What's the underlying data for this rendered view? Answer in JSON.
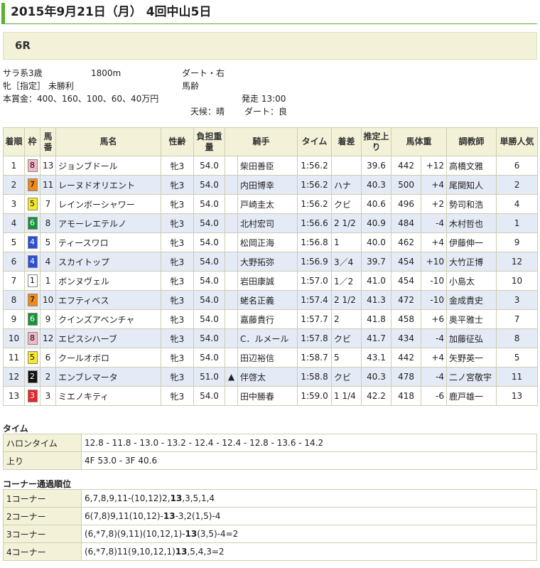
{
  "header": {
    "title": "2015年9月21日（月） 4回中山5日"
  },
  "race": {
    "name": "6R",
    "class_line": "サラ系3歳",
    "distance": "1800m",
    "track": "ダート・右",
    "conditions": "牝［指定］ 未勝利",
    "weight_rule": "馬齢",
    "prize": "本賞金：400、160、100、60、40万円",
    "start": "発走 13:00",
    "weather": "天候：晴",
    "going": "ダート：良"
  },
  "table": {
    "headers": [
      "着順",
      "枠",
      "馬番",
      "馬名",
      "性齢",
      "負担重量",
      "騎手",
      "タイム",
      "着差",
      "推定上り",
      "馬体重",
      "調教師",
      "単勝人気"
    ],
    "rows": [
      {
        "pos": "1",
        "waku": "8",
        "num": "13",
        "name": "ジョンブドール",
        "sex": "牝3",
        "wt": "54.0",
        "mark": "",
        "jockey": "柴田善臣",
        "time": "1:56.2",
        "margin": "",
        "last": "39.6",
        "bw": "442",
        "diff": "+12",
        "trainer": "高橋文雅",
        "pop": "6"
      },
      {
        "pos": "2",
        "waku": "7",
        "num": "11",
        "name": "レーヌドオリエント",
        "sex": "牝3",
        "wt": "54.0",
        "mark": "",
        "jockey": "内田博幸",
        "time": "1:56.2",
        "margin": "ハナ",
        "last": "40.3",
        "bw": "500",
        "diff": "+4",
        "trainer": "尾関知人",
        "pop": "2"
      },
      {
        "pos": "3",
        "waku": "5",
        "num": "7",
        "name": "レインボーシャワー",
        "sex": "牝3",
        "wt": "54.0",
        "mark": "",
        "jockey": "戸崎圭太",
        "time": "1:56.2",
        "margin": "クビ",
        "last": "40.6",
        "bw": "496",
        "diff": "+2",
        "trainer": "勢司和浩",
        "pop": "4"
      },
      {
        "pos": "4",
        "waku": "6",
        "num": "8",
        "name": "アモーレエテルノ",
        "sex": "牝3",
        "wt": "54.0",
        "mark": "",
        "jockey": "北村宏司",
        "time": "1:56.6",
        "margin": "2 1/2",
        "last": "40.9",
        "bw": "484",
        "diff": "-4",
        "trainer": "木村哲也",
        "pop": "1"
      },
      {
        "pos": "5",
        "waku": "4",
        "num": "5",
        "name": "ティースワロ",
        "sex": "牝3",
        "wt": "54.0",
        "mark": "",
        "jockey": "松岡正海",
        "time": "1:56.8",
        "margin": "1",
        "last": "40.0",
        "bw": "462",
        "diff": "+4",
        "trainer": "伊藤伸一",
        "pop": "9"
      },
      {
        "pos": "6",
        "waku": "4",
        "num": "4",
        "name": "スカイトップ",
        "sex": "牝3",
        "wt": "54.0",
        "mark": "",
        "jockey": "大野拓弥",
        "time": "1:56.9",
        "margin": "3／4",
        "last": "39.7",
        "bw": "454",
        "diff": "+10",
        "trainer": "大竹正博",
        "pop": "12"
      },
      {
        "pos": "7",
        "waku": "1",
        "num": "1",
        "name": "ボンヌヴェル",
        "sex": "牝3",
        "wt": "54.0",
        "mark": "",
        "jockey": "岩田康誠",
        "time": "1:57.0",
        "margin": "1／2",
        "last": "41.0",
        "bw": "454",
        "diff": "-10",
        "trainer": "小島太",
        "pop": "10"
      },
      {
        "pos": "8",
        "waku": "7",
        "num": "10",
        "name": "エフティベス",
        "sex": "牝3",
        "wt": "54.0",
        "mark": "",
        "jockey": "蛯名正義",
        "time": "1:57.4",
        "margin": "2 1/2",
        "last": "41.3",
        "bw": "472",
        "diff": "-10",
        "trainer": "金成貴史",
        "pop": "3"
      },
      {
        "pos": "9",
        "waku": "6",
        "num": "9",
        "name": "クインズアベンチャ",
        "sex": "牝3",
        "wt": "54.0",
        "mark": "",
        "jockey": "嘉藤貴行",
        "time": "1:57.7",
        "margin": "2",
        "last": "41.8",
        "bw": "458",
        "diff": "+6",
        "trainer": "奥平雅士",
        "pop": "7"
      },
      {
        "pos": "10",
        "waku": "8",
        "num": "12",
        "name": "エピスシハーブ",
        "sex": "牝3",
        "wt": "54.0",
        "mark": "",
        "jockey": "C．ルメール",
        "time": "1:57.8",
        "margin": "クビ",
        "last": "41.7",
        "bw": "434",
        "diff": "-4",
        "trainer": "加藤征弘",
        "pop": "8"
      },
      {
        "pos": "11",
        "waku": "5",
        "num": "6",
        "name": "クールオボロ",
        "sex": "牝3",
        "wt": "54.0",
        "mark": "",
        "jockey": "田辺裕信",
        "time": "1:58.7",
        "margin": "5",
        "last": "43.1",
        "bw": "442",
        "diff": "+4",
        "trainer": "矢野英一",
        "pop": "5"
      },
      {
        "pos": "12",
        "waku": "2",
        "num": "2",
        "name": "エンブレマータ",
        "sex": "牝3",
        "wt": "51.0",
        "mark": "▲",
        "jockey": "伴啓太",
        "time": "1:58.8",
        "margin": "クビ",
        "last": "40.3",
        "bw": "478",
        "diff": "-4",
        "trainer": "二ノ宮敬宇",
        "pop": "11"
      },
      {
        "pos": "13",
        "waku": "3",
        "num": "3",
        "name": "ミエノキティ",
        "sex": "牝3",
        "wt": "54.0",
        "mark": "",
        "jockey": "田中勝春",
        "time": "1:59.0",
        "margin": "1 1/4",
        "last": "42.2",
        "bw": "418",
        "diff": "-6",
        "trainer": "鹿戸雄一",
        "pop": "13"
      }
    ]
  },
  "waku_colors": {
    "1": {
      "bg": "#ffffff",
      "fg": "#000000"
    },
    "2": {
      "bg": "#111111",
      "fg": "#ffffff"
    },
    "3": {
      "bg": "#e8262a",
      "fg": "#ffffff"
    },
    "4": {
      "bg": "#2a4fd6",
      "fg": "#ffffff"
    },
    "5": {
      "bg": "#f7e92a",
      "fg": "#000000"
    },
    "6": {
      "bg": "#16923a",
      "fg": "#ffffff"
    },
    "7": {
      "bg": "#f08a1c",
      "fg": "#000000"
    },
    "8": {
      "bg": "#f5b7c5",
      "fg": "#000000"
    }
  },
  "time_section": {
    "title": "タイム",
    "rows": [
      {
        "label": "ハロンタイム",
        "value": "12.8 - 11.8 - 13.0 - 13.2 - 12.4 - 12.4 - 12.8 - 13.6 - 14.2"
      },
      {
        "label": "上り",
        "value": "4F 53.0 - 3F 40.6"
      }
    ]
  },
  "corner_section": {
    "title": "コーナー通過順位",
    "rows": [
      {
        "label": "1コーナー",
        "pre": "6,7,8,9,11-(10,12)2,",
        "hl": "13",
        "post": ",3,5,1,4"
      },
      {
        "label": "2コーナー",
        "pre": "6(7,8)9,11(10,12)-",
        "hl": "13",
        "post": "-3,2(1,5)-4"
      },
      {
        "label": "3コーナー",
        "pre": "(6,*7,8)(9,11)(10,12,1)-",
        "hl": "13",
        "post": "(3,5)-4=2"
      },
      {
        "label": "4コーナー",
        "pre": "(6,*7,8)11(9,10,12,1)",
        "hl": "13",
        "post": ",5,4,3=2"
      }
    ]
  }
}
